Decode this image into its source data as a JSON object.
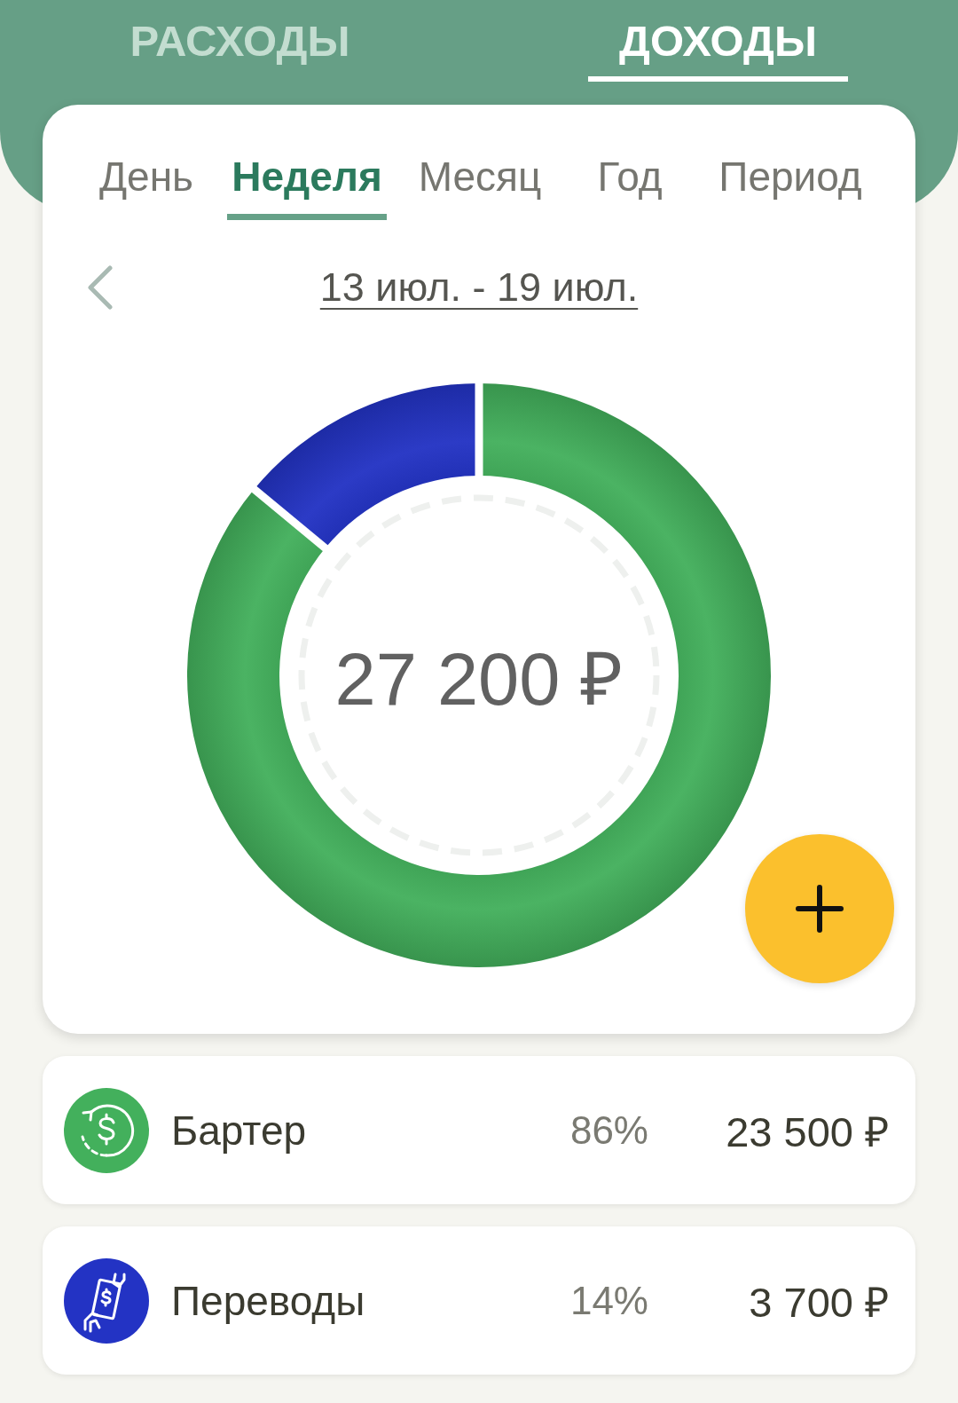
{
  "top_tabs": [
    {
      "label": "РАСХОДЫ",
      "selected": false
    },
    {
      "label": "ДОХОДЫ",
      "selected": true
    }
  ],
  "period_tabs": [
    {
      "label": "День",
      "selected": false
    },
    {
      "label": "Неделя",
      "selected": true
    },
    {
      "label": "Месяц",
      "selected": false
    },
    {
      "label": "Год",
      "selected": false
    },
    {
      "label": "Период",
      "selected": false
    }
  ],
  "date_range": {
    "label": "13 июл. - 19 июл."
  },
  "chart": {
    "total": "27 200 ₽",
    "chart_data": {
      "type": "donut",
      "values": [
        86,
        14
      ]
    }
  },
  "categories": [
    {
      "name": "Бартер",
      "percent": "86%",
      "amount": "23 500 ₽",
      "color": "#43b05c"
    },
    {
      "name": "Переводы",
      "percent": "14%",
      "amount": "3 700 ₽",
      "color": "#2333c4"
    }
  ]
}
